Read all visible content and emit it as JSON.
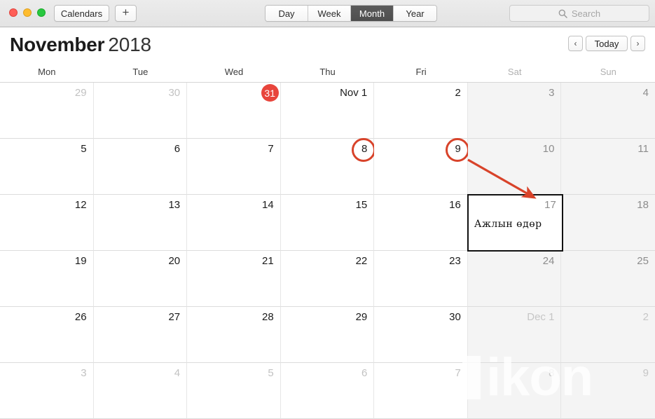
{
  "window": {
    "traffic_lights": [
      {
        "name": "close",
        "color": "#ff5f57"
      },
      {
        "name": "minimize",
        "color": "#febc2e"
      },
      {
        "name": "zoom",
        "color": "#28c840"
      }
    ]
  },
  "toolbar": {
    "calendars_label": "Calendars",
    "add_label": "+",
    "views": [
      {
        "label": "Day",
        "active": false
      },
      {
        "label": "Week",
        "active": false
      },
      {
        "label": "Month",
        "active": true
      },
      {
        "label": "Year",
        "active": false
      }
    ],
    "search": {
      "placeholder": "Search",
      "value": "",
      "icon": "search-icon"
    }
  },
  "header": {
    "month": "November",
    "year": "2018",
    "prev_label": "‹",
    "today_label": "Today",
    "next_label": "›"
  },
  "weekdays": [
    {
      "label": "Mon",
      "weekend": false
    },
    {
      "label": "Tue",
      "weekend": false
    },
    {
      "label": "Wed",
      "weekend": false
    },
    {
      "label": "Thu",
      "weekend": false
    },
    {
      "label": "Fri",
      "weekend": false
    },
    {
      "label": "Sat",
      "weekend": true
    },
    {
      "label": "Sun",
      "weekend": true
    }
  ],
  "days": [
    {
      "label": "29",
      "muted": true,
      "weekend": false
    },
    {
      "label": "30",
      "muted": true,
      "weekend": false
    },
    {
      "label": "31",
      "muted": true,
      "weekend": false,
      "today": true
    },
    {
      "label": "Nov 1",
      "muted": false,
      "weekend": false
    },
    {
      "label": "2",
      "muted": false,
      "weekend": false
    },
    {
      "label": "3",
      "muted": false,
      "weekend": true
    },
    {
      "label": "4",
      "muted": false,
      "weekend": true
    },
    {
      "label": "5",
      "muted": false,
      "weekend": false
    },
    {
      "label": "6",
      "muted": false,
      "weekend": false
    },
    {
      "label": "7",
      "muted": false,
      "weekend": false
    },
    {
      "label": "8",
      "muted": false,
      "weekend": false,
      "circled": true
    },
    {
      "label": "9",
      "muted": false,
      "weekend": false,
      "circled": true
    },
    {
      "label": "10",
      "muted": false,
      "weekend": true
    },
    {
      "label": "11",
      "muted": false,
      "weekend": true
    },
    {
      "label": "12",
      "muted": false,
      "weekend": false
    },
    {
      "label": "13",
      "muted": false,
      "weekend": false
    },
    {
      "label": "14",
      "muted": false,
      "weekend": false
    },
    {
      "label": "15",
      "muted": false,
      "weekend": false
    },
    {
      "label": "16",
      "muted": false,
      "weekend": false
    },
    {
      "label": "17",
      "muted": false,
      "weekend": true,
      "event": "Ажлын өдөр",
      "selected": true
    },
    {
      "label": "18",
      "muted": false,
      "weekend": true
    },
    {
      "label": "19",
      "muted": false,
      "weekend": false
    },
    {
      "label": "20",
      "muted": false,
      "weekend": false
    },
    {
      "label": "21",
      "muted": false,
      "weekend": false
    },
    {
      "label": "22",
      "muted": false,
      "weekend": false
    },
    {
      "label": "23",
      "muted": false,
      "weekend": false
    },
    {
      "label": "24",
      "muted": false,
      "weekend": true
    },
    {
      "label": "25",
      "muted": false,
      "weekend": true
    },
    {
      "label": "26",
      "muted": false,
      "weekend": false
    },
    {
      "label": "27",
      "muted": false,
      "weekend": false
    },
    {
      "label": "28",
      "muted": false,
      "weekend": false
    },
    {
      "label": "29",
      "muted": false,
      "weekend": false
    },
    {
      "label": "30",
      "muted": false,
      "weekend": false
    },
    {
      "label": "Dec 1",
      "muted": true,
      "weekend": true
    },
    {
      "label": "2",
      "muted": true,
      "weekend": true
    },
    {
      "label": "3",
      "muted": true,
      "weekend": false
    },
    {
      "label": "4",
      "muted": true,
      "weekend": false
    },
    {
      "label": "5",
      "muted": true,
      "weekend": false
    },
    {
      "label": "6",
      "muted": true,
      "weekend": false
    },
    {
      "label": "7",
      "muted": true,
      "weekend": false
    },
    {
      "label": "8",
      "muted": true,
      "weekend": true
    },
    {
      "label": "9",
      "muted": true,
      "weekend": true
    }
  ],
  "annotations": {
    "circle_color": "#d8432a",
    "arrow_color": "#d8432a",
    "box_color": "#111111",
    "circled_days": [
      "8",
      "9"
    ],
    "arrow_from_day": "9",
    "arrow_to_day": "17"
  },
  "watermark": {
    "text": "ikon"
  }
}
